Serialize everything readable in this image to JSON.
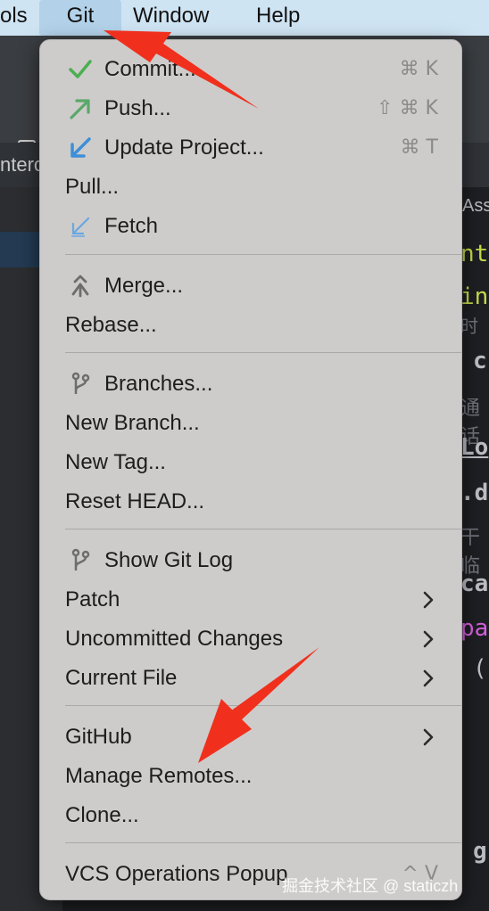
{
  "menubar": {
    "items": [
      "ols",
      "Git",
      "Window",
      "Help"
    ]
  },
  "ide": {
    "tab_fragment": "nterc",
    "tab_fragment_right": "Ass",
    "code_fragments": [
      "nt",
      "in",
      "c",
      "Lo",
      ".d",
      "ca",
      "pa",
      "(",
      "g",
      "}"
    ],
    "cjk_fragments": [
      "时",
      "通话",
      "干临"
    ]
  },
  "git_menu": {
    "commit": {
      "label": "Commit...",
      "shortcut": "⌘ K"
    },
    "push": {
      "label": "Push...",
      "shortcut": "⇧ ⌘ K"
    },
    "update_project": {
      "label": "Update Project...",
      "shortcut": "⌘ T"
    },
    "pull": {
      "label": "Pull..."
    },
    "fetch": {
      "label": "Fetch"
    },
    "merge": {
      "label": "Merge..."
    },
    "rebase": {
      "label": "Rebase..."
    },
    "branches": {
      "label": "Branches..."
    },
    "new_branch": {
      "label": "New Branch..."
    },
    "new_tag": {
      "label": "New Tag..."
    },
    "reset_head": {
      "label": "Reset HEAD..."
    },
    "show_git_log": {
      "label": "Show Git Log"
    },
    "patch": {
      "label": "Patch"
    },
    "uncommitted_changes": {
      "label": "Uncommitted Changes"
    },
    "current_file": {
      "label": "Current File"
    },
    "github": {
      "label": "GitHub"
    },
    "manage_remotes": {
      "label": "Manage Remotes..."
    },
    "clone": {
      "label": "Clone..."
    },
    "vcs_operations_popup": {
      "label": "VCS Operations Popup",
      "shortcut": "^ V"
    }
  },
  "watermark": "掘金技术社区 @ staticzh",
  "colors": {
    "menubar_bg": "#cfe4f3",
    "menu_bg": "#cdcccb",
    "annotation_arrow": "#f0301d",
    "commit_check": "#4caf50",
    "push_arrow": "#5aa86a",
    "update_arrow": "#3d8fd8"
  }
}
